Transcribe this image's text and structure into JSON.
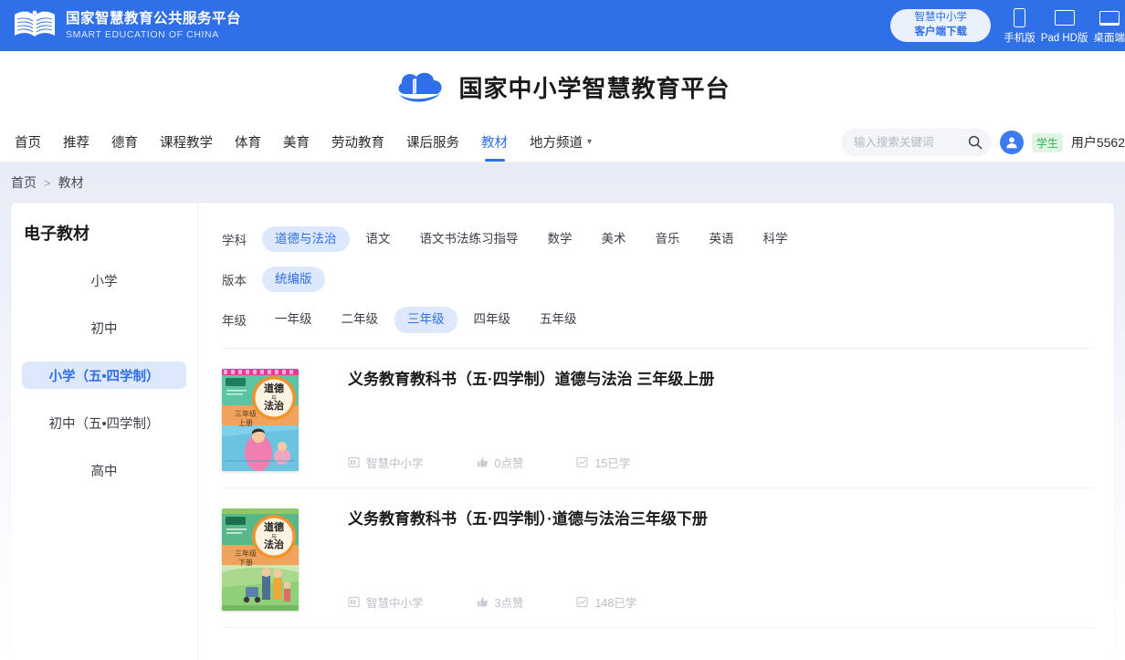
{
  "top_bar": {
    "brand_cn": "国家智慧教育公共服务平台",
    "brand_en": "SMART EDUCATION OF CHINA",
    "logo_icon": "open-book-icon",
    "download_button": {
      "line1": "智慧中小学",
      "line2": "客户端下载"
    },
    "devices": [
      {
        "label": "手机版",
        "icon": "phone-icon"
      },
      {
        "label": "Pad HD版",
        "icon": "tablet-icon"
      },
      {
        "label": "桌面端",
        "icon": "desktop-icon"
      }
    ]
  },
  "logo_band": {
    "title": "国家中小学智慧教育平台",
    "icon": "cloud-book-logo-icon"
  },
  "nav": {
    "items": [
      {
        "label": "首页",
        "active": false
      },
      {
        "label": "推荐",
        "active": false
      },
      {
        "label": "德育",
        "active": false
      },
      {
        "label": "课程教学",
        "active": false
      },
      {
        "label": "体育",
        "active": false
      },
      {
        "label": "美育",
        "active": false
      },
      {
        "label": "劳动教育",
        "active": false
      },
      {
        "label": "课后服务",
        "active": false
      },
      {
        "label": "教材",
        "active": true
      },
      {
        "label": "地方频道",
        "active": false,
        "has_chevron": true
      }
    ],
    "search": {
      "placeholder": "输入搜索关键词",
      "value": "",
      "icon": "search-icon"
    },
    "user": {
      "avatar_icon": "user-avatar-icon",
      "role_badge": "学生",
      "name": "用户5562"
    }
  },
  "breadcrumb": {
    "home": "首页",
    "separator": ">",
    "current": "教材"
  },
  "sidebar": {
    "title": "电子教材",
    "items": [
      {
        "label": "小学",
        "active": false
      },
      {
        "label": "初中",
        "active": false
      },
      {
        "label": "小学（五•四学制）",
        "active": true
      },
      {
        "label": "初中（五•四学制）",
        "active": false
      },
      {
        "label": "高中",
        "active": false
      }
    ]
  },
  "filters": [
    {
      "label": "学科",
      "chips": [
        {
          "label": "道德与法治",
          "active": true
        },
        {
          "label": "语文",
          "active": false
        },
        {
          "label": "语文书法练习指导",
          "active": false
        },
        {
          "label": "数学",
          "active": false
        },
        {
          "label": "美术",
          "active": false
        },
        {
          "label": "音乐",
          "active": false
        },
        {
          "label": "英语",
          "active": false
        },
        {
          "label": "科学",
          "active": false
        }
      ]
    },
    {
      "label": "版本",
      "chips": [
        {
          "label": "统编版",
          "active": true
        }
      ]
    },
    {
      "label": "年级",
      "chips": [
        {
          "label": "一年级",
          "active": false
        },
        {
          "label": "二年级",
          "active": false
        },
        {
          "label": "三年级",
          "active": true
        },
        {
          "label": "四年级",
          "active": false
        },
        {
          "label": "五年级",
          "active": false
        }
      ]
    }
  ],
  "books": [
    {
      "title": "义务教育教科书（五·四学制）道德与法治 三年级上册",
      "cover_theme": "pink",
      "cover_subject": "道德\n与\n法治",
      "cover_grade": "三年级",
      "cover_term": "上册",
      "meta": {
        "source": {
          "icon": "book-source-icon",
          "text": "智慧中小学"
        },
        "likes": {
          "icon": "thumbs-up-icon",
          "text": "0点赞"
        },
        "studied": {
          "icon": "study-count-icon",
          "text": "15已学"
        }
      }
    },
    {
      "title": "义务教育教科书（五·四学制）·道德与法治三年级下册",
      "cover_theme": "green",
      "cover_subject": "道德\n与\n法治",
      "cover_grade": "三年级",
      "cover_term": "下册",
      "meta": {
        "source": {
          "icon": "book-source-icon",
          "text": "智慧中小学"
        },
        "likes": {
          "icon": "thumbs-up-icon",
          "text": "3点赞"
        },
        "studied": {
          "icon": "study-count-icon",
          "text": "148已学"
        }
      }
    }
  ],
  "colors": {
    "header_blue": "#2f6fe8",
    "accent_blue": "#2f6fe8",
    "chip_active_bg": "#dde8fd",
    "badge_green_bg": "#dff5e1",
    "badge_green_text": "#33b555"
  }
}
